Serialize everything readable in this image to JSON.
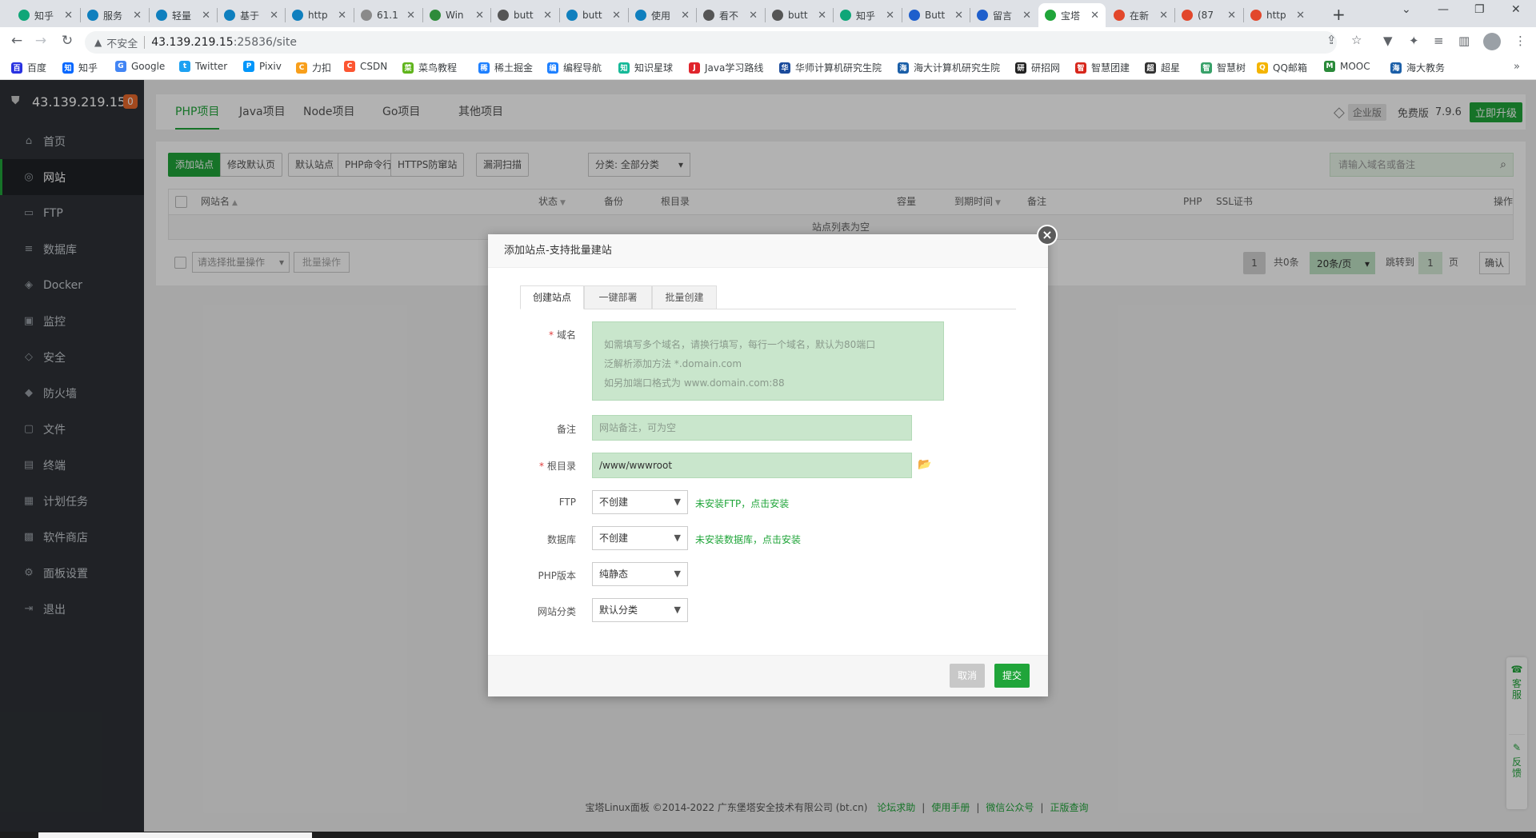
{
  "browser": {
    "tabs": [
      {
        "title": "知乎",
        "color": "#0fa678"
      },
      {
        "title": "服务",
        "color": "#0f7fbe"
      },
      {
        "title": "轻量",
        "color": "#0f7fbe"
      },
      {
        "title": "基于",
        "color": "#0f7fbe"
      },
      {
        "title": "http",
        "color": "#0f7fbe"
      },
      {
        "title": "61.1",
        "color": "#8a8a8a"
      },
      {
        "title": "Win",
        "color": "#2e8b3a"
      },
      {
        "title": "butt",
        "color": "#555555"
      },
      {
        "title": "butt",
        "color": "#0f7fbe"
      },
      {
        "title": "使用",
        "color": "#0f7fbe"
      },
      {
        "title": "看不",
        "color": "#555555"
      },
      {
        "title": "butt",
        "color": "#555555"
      },
      {
        "title": "知乎",
        "color": "#0fa678"
      },
      {
        "title": "Butt",
        "color": "#1e5fcc"
      },
      {
        "title": "留言",
        "color": "#1e5fcc"
      },
      {
        "title": "宝塔",
        "color": "#20a53a"
      },
      {
        "title": "在新",
        "color": "#e2472b"
      },
      {
        "title": "(87",
        "color": "#e2472b"
      },
      {
        "title": "http",
        "color": "#e2472b"
      }
    ],
    "active_tab_index": 15,
    "address": {
      "security_label": "不安全",
      "host": "43.139.219.15",
      "path": ":25836/site"
    },
    "bookmarks": [
      {
        "label": "百度",
        "color": "#2932e1",
        "glyph": "百"
      },
      {
        "label": "知乎",
        "color": "#0066ff",
        "glyph": "知"
      },
      {
        "label": "Google",
        "color": "#4285f4",
        "glyph": "G"
      },
      {
        "label": "Twitter",
        "color": "#1da1f2",
        "glyph": "t"
      },
      {
        "label": "Pixiv",
        "color": "#0096fa",
        "glyph": "P"
      },
      {
        "label": "力扣",
        "color": "#f89f1b",
        "glyph": "C"
      },
      {
        "label": "CSDN",
        "color": "#fc5531",
        "glyph": "C"
      },
      {
        "label": "菜鸟教程",
        "color": "#5fb41b",
        "glyph": "菜"
      },
      {
        "label": "稀土掘金",
        "color": "#1e80ff",
        "glyph": "稀"
      },
      {
        "label": "编程导航",
        "color": "#1e80ff",
        "glyph": "编"
      },
      {
        "label": "知识星球",
        "color": "#16b998",
        "glyph": "知"
      },
      {
        "label": "Java学习路线",
        "color": "#e0242c",
        "glyph": "J"
      },
      {
        "label": "华师计算机研究生院",
        "color": "#1b4b9b",
        "glyph": "华"
      },
      {
        "label": "海大计算机研究生院",
        "color": "#1b5fa8",
        "glyph": "海"
      },
      {
        "label": "研招网",
        "color": "#222222",
        "glyph": "研"
      },
      {
        "label": "智慧团建",
        "color": "#d7261b",
        "glyph": "智"
      },
      {
        "label": "超星",
        "color": "#333333",
        "glyph": "超"
      },
      {
        "label": "智慧树",
        "color": "#38a169",
        "glyph": "智"
      },
      {
        "label": "QQ邮箱",
        "color": "#f4b400",
        "glyph": "Q"
      },
      {
        "label": "MOOC",
        "color": "#2a8a3a",
        "glyph": "M"
      },
      {
        "label": "海大教务",
        "color": "#1b5fa8",
        "glyph": "海"
      }
    ]
  },
  "sidebar": {
    "host": "43.139.219.15",
    "badge": "0",
    "items": [
      {
        "label": "首页",
        "icon": "home-icon",
        "glyph": "⌂"
      },
      {
        "label": "网站",
        "icon": "globe-icon",
        "glyph": "◎"
      },
      {
        "label": "FTP",
        "icon": "ftp-icon",
        "glyph": "▭"
      },
      {
        "label": "数据库",
        "icon": "database-icon",
        "glyph": "≡"
      },
      {
        "label": "Docker",
        "icon": "docker-icon",
        "glyph": "◈"
      },
      {
        "label": "监控",
        "icon": "monitor-icon",
        "glyph": "▣"
      },
      {
        "label": "安全",
        "icon": "security-icon",
        "glyph": "◇"
      },
      {
        "label": "防火墙",
        "icon": "firewall-icon",
        "glyph": "◆"
      },
      {
        "label": "文件",
        "icon": "folder-icon",
        "glyph": "▢"
      },
      {
        "label": "终端",
        "icon": "terminal-icon",
        "glyph": "▤"
      },
      {
        "label": "计划任务",
        "icon": "task-icon",
        "glyph": "▦"
      },
      {
        "label": "软件商店",
        "icon": "store-icon",
        "glyph": "▩"
      },
      {
        "label": "面板设置",
        "icon": "settings-icon",
        "glyph": "⚙"
      },
      {
        "label": "退出",
        "icon": "logout-icon",
        "glyph": "⇥"
      }
    ],
    "active_index": 1
  },
  "topnav": {
    "tabs": [
      "PHP项目",
      "Java项目",
      "Node项目",
      "Go项目",
      "其他项目"
    ],
    "active_index": 0,
    "enterprise": "企业版",
    "free": "免费版",
    "version": "7.9.6",
    "upgrade": "立即升级"
  },
  "toolbar": {
    "buttons": [
      "添加站点",
      "修改默认页",
      "默认站点",
      "PHP命令行版本",
      "HTTPS防窜站",
      "漏洞扫描"
    ],
    "category": "分类: 全部分类",
    "search_placeholder": "请输入域名或备注"
  },
  "table": {
    "headers": [
      "网站名",
      "状态",
      "备份",
      "根目录",
      "容量",
      "到期时间",
      "备注",
      "PHP",
      "SSL证书",
      "操作"
    ],
    "sort_indicators": {
      "网站名": "▲",
      "状态": "▼",
      "到期时间": "▼"
    },
    "empty_text": "站点列表为空"
  },
  "batch": {
    "select_placeholder": "请选择批量操作",
    "button": "批量操作"
  },
  "pagination": {
    "current": "1",
    "total": "共0条",
    "page_size": "20条/页",
    "jump_label": "跳转到",
    "jump_value": "1",
    "page_unit": "页",
    "confirm": "确认"
  },
  "footer": {
    "copyright": "宝塔Linux面板 ©2014-2022 广东堡塔安全技术有限公司 (bt.cn)",
    "links": [
      "论坛求助",
      "使用手册",
      "微信公众号",
      "正版查询"
    ]
  },
  "float": {
    "service": "客服",
    "feedback": "反馈"
  },
  "modal": {
    "title": "添加站点-支持批量建站",
    "tabs": [
      "创建站点",
      "一键部署",
      "批量创建"
    ],
    "active_tab": 0,
    "domain": {
      "label": "域名",
      "placeholder_lines": [
        "如需填写多个域名，请换行填写，每行一个域名，默认为80端口",
        "泛解析添加方法 *.domain.com",
        "如另加端口格式为 www.domain.com:88"
      ]
    },
    "remark": {
      "label": "备注",
      "placeholder": "网站备注，可为空"
    },
    "root": {
      "label": "根目录",
      "value": "/www/wwwroot"
    },
    "ftp": {
      "label": "FTP",
      "value": "不创建",
      "hint": "未安装FTP，点击安装"
    },
    "database": {
      "label": "数据库",
      "value": "不创建",
      "hint": "未安装数据库，点击安装"
    },
    "php": {
      "label": "PHP版本",
      "value": "纯静态"
    },
    "category": {
      "label": "网站分类",
      "value": "默认分类"
    },
    "cancel": "取消",
    "submit": "提交"
  }
}
